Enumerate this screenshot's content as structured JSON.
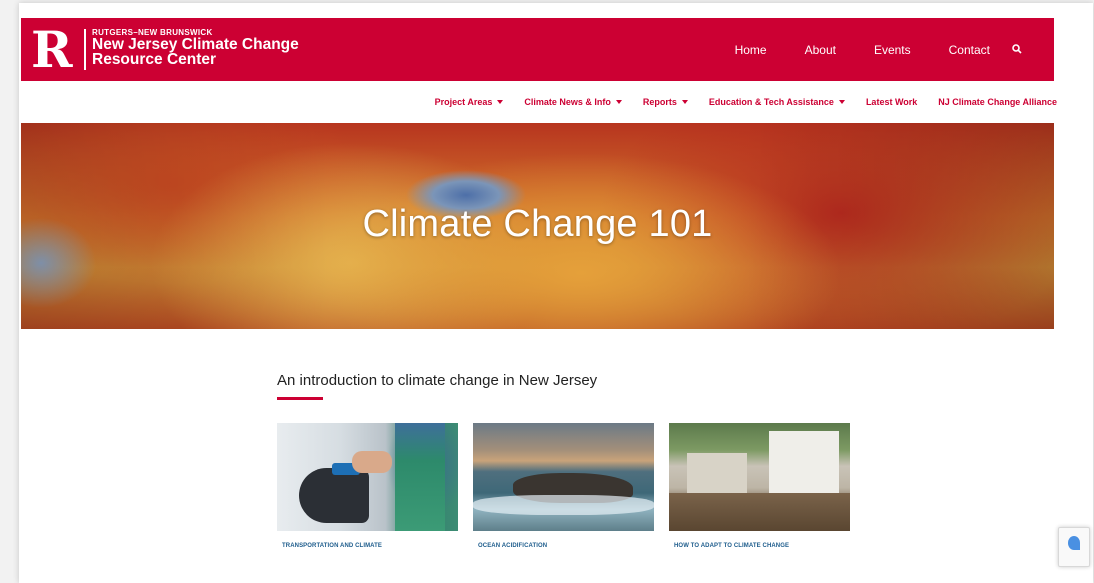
{
  "brand": {
    "small": "RUTGERS–NEW BRUNSWICK",
    "line1": "New Jersey Climate Change",
    "line2": "Resource Center",
    "logo_letter": "R",
    "color": "#cc0033"
  },
  "topnav": {
    "items": [
      "Home",
      "About",
      "Events",
      "Contact"
    ],
    "search_icon": "search-icon"
  },
  "subnav": {
    "items": [
      {
        "label": "Project Areas",
        "dropdown": true
      },
      {
        "label": "Climate News & Info",
        "dropdown": true
      },
      {
        "label": "Reports",
        "dropdown": true
      },
      {
        "label": "Education & Tech Assistance",
        "dropdown": true
      },
      {
        "label": "Latest Work",
        "dropdown": false
      },
      {
        "label": "NJ Climate Change Alliance",
        "dropdown": false
      }
    ]
  },
  "hero": {
    "title": "Climate Change 101"
  },
  "main": {
    "heading": "An introduction to climate change in New Jersey",
    "cards": [
      {
        "caption": "TRANSPORTATION AND CLIMATE"
      },
      {
        "caption": "OCEAN ACIDIFICATION"
      },
      {
        "caption": "HOW TO ADAPT TO CLIMATE CHANGE"
      }
    ]
  }
}
